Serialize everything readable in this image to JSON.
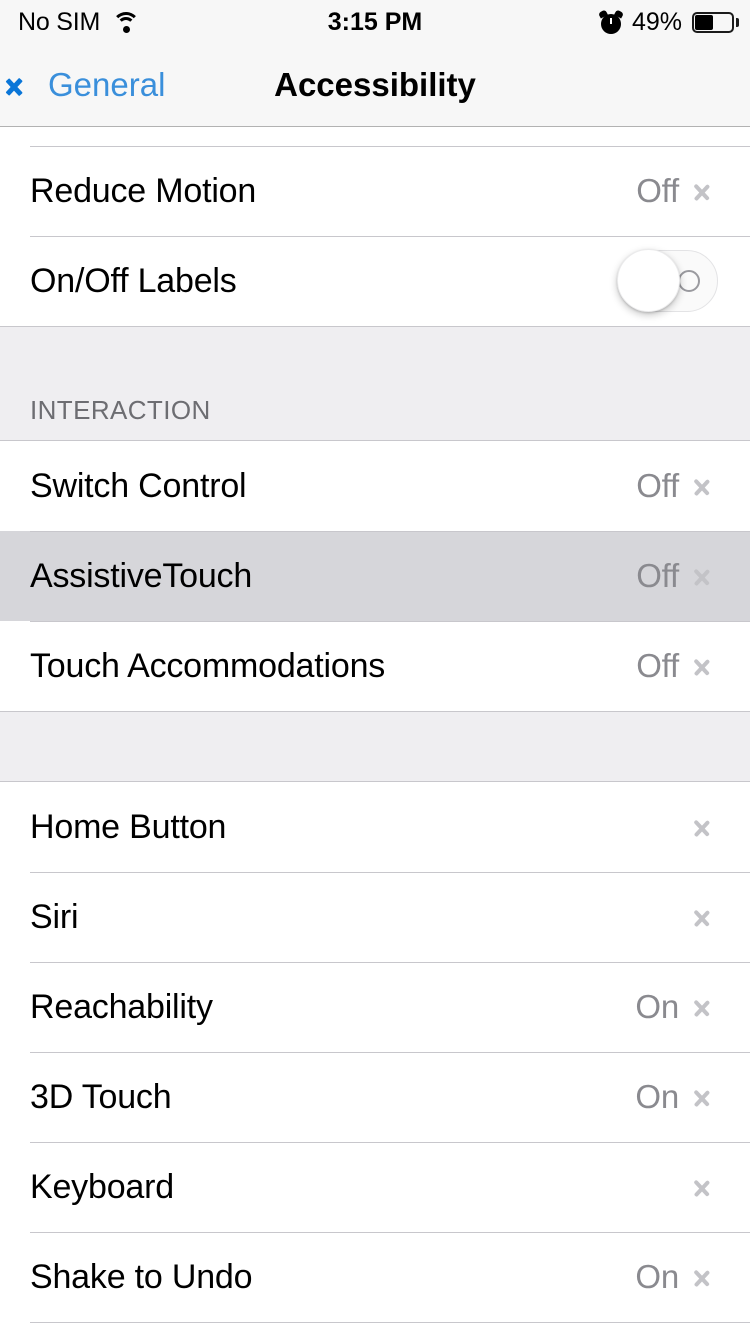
{
  "status_bar": {
    "carrier": "No SIM",
    "wifi_icon": "wifi-icon",
    "time": "3:15 PM",
    "alarm_icon": "alarm-clock-icon",
    "battery_percent": "49%",
    "battery_level": 49,
    "battery_icon": "battery-icon"
  },
  "nav": {
    "back_label": "General",
    "back_icon": "chevron-left-icon",
    "title": "Accessibility"
  },
  "colors": {
    "accent_blue": "#007aff",
    "value_gray": "#8a8a8f",
    "chevron_gray": "#c3c3c7",
    "separator": "#c8c7cc",
    "group_bg": "#efeef1",
    "pressed_row": "#d6d6da"
  },
  "sections": [
    {
      "type": "rows",
      "header": null,
      "rows": [
        {
          "label": "Reduce Motion",
          "value": "Off",
          "accessory": "chevron",
          "pressed": false,
          "first": false
        },
        {
          "label": "On/Off Labels",
          "value": "",
          "accessory": "switch",
          "switch_state": "off",
          "switch_off_glyph": "O",
          "pressed": false,
          "first": false
        }
      ]
    },
    {
      "type": "header",
      "header": "INTERACTION"
    },
    {
      "type": "rows",
      "rows": [
        {
          "label": "Switch Control",
          "value": "Off",
          "accessory": "chevron",
          "pressed": false,
          "first": true
        },
        {
          "label": "AssistiveTouch",
          "value": "Off",
          "accessory": "chevron",
          "pressed": true,
          "first": false
        },
        {
          "label": "Touch Accommodations",
          "value": "Off",
          "accessory": "chevron",
          "pressed": false,
          "first": false
        }
      ]
    },
    {
      "type": "gap"
    },
    {
      "type": "rows",
      "rows": [
        {
          "label": "Home Button",
          "value": "",
          "accessory": "chevron",
          "pressed": false,
          "first": true
        },
        {
          "label": "Siri",
          "value": "",
          "accessory": "chevron",
          "pressed": false,
          "first": false
        },
        {
          "label": "Reachability",
          "value": "On",
          "accessory": "chevron",
          "pressed": false,
          "first": false
        },
        {
          "label": "3D Touch",
          "value": "On",
          "accessory": "chevron",
          "pressed": false,
          "first": false
        },
        {
          "label": "Keyboard",
          "value": "",
          "accessory": "chevron",
          "pressed": false,
          "first": false
        },
        {
          "label": "Shake to Undo",
          "value": "On",
          "accessory": "chevron",
          "pressed": false,
          "first": false
        }
      ]
    }
  ]
}
